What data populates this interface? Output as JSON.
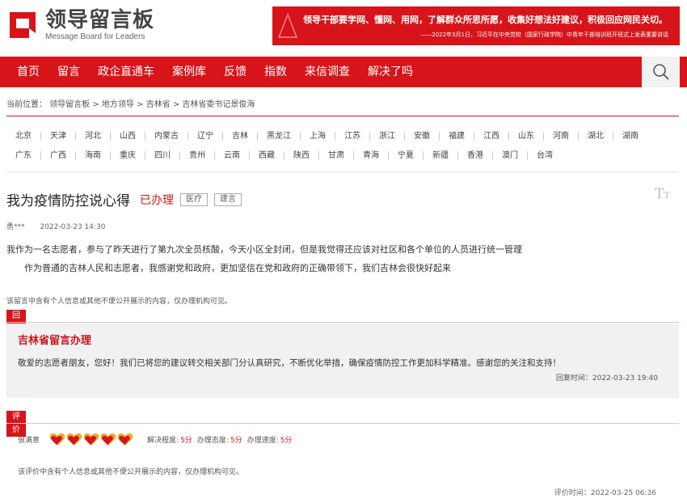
{
  "header": {
    "logo_title": "领导留言板",
    "logo_subtitle": "Message Board for Leaders",
    "banner_main": "领导干部要学网、懂网、用网，了解群众所思所愿，收集好想法好建议，积极回应网民关切。",
    "banner_sub": "——2022年3月1日，习近平在中央党校（国家行政学院）中青年干部培训班开班式上发表重要讲话"
  },
  "nav": {
    "items": [
      "首页",
      "留言",
      "政企直通车",
      "案例库",
      "反馈",
      "指数",
      "来信调查",
      "解决了吗"
    ]
  },
  "breadcrumb": {
    "prefix": "当前位置：",
    "path": "领导留言板 > 地方领导 > 吉林省 > 吉林省委书记景俊海"
  },
  "regions": {
    "row1": [
      "北京",
      "天津",
      "河北",
      "山西",
      "内蒙古",
      "辽宁",
      "吉林",
      "黑龙江",
      "上海",
      "江苏",
      "浙江",
      "安徽",
      "福建",
      "江西",
      "山东",
      "河南",
      "湖北",
      "湖南"
    ],
    "row2": [
      "广东",
      "广西",
      "海南",
      "重庆",
      "四川",
      "贵州",
      "云南",
      "西藏",
      "陕西",
      "甘肃",
      "青海",
      "宁夏",
      "新疆",
      "香港",
      "澳门",
      "台湾"
    ]
  },
  "message": {
    "title": "我为疫情防控说心得",
    "status": "已办理",
    "tags": [
      "医疗",
      "建言"
    ],
    "author": "勇***",
    "date": "2022-03-23 14:30",
    "para1": "我作为一名志愿者，参与了昨天进行了第九次全员核酸，今天小区全封闭，但是我觉得还应该对社区和各个单位的人员进行统一管理",
    "para2": "作为普通的吉林人民和志愿者，我感谢党和政府，更加坚信在党和政府的正确带领下，我们吉林会很快好起来",
    "privacy_note": "该留言中含有个人信息或其他不便公开展示的内容，仅办理机构可见。"
  },
  "reply": {
    "label": "回复",
    "org": "吉林省留言办理",
    "text": "敬爱的志愿者朋友，您好！我们已将您的建议转交相关部门分认真研究，不断优化举措，确保疫情防控工作更加科学精准。感谢您的关注和支持！",
    "time": "回复时间：2022-03-23 19:40"
  },
  "rating": {
    "label": "评价",
    "overall": "很满意",
    "hearts": 5,
    "resolve_label": "解决程度:",
    "resolve_score": "5分",
    "attitude_label": "办理态度:",
    "attitude_score": "5分",
    "speed_label": "办理速度:",
    "speed_score": "5分",
    "note": "该评价中含有个人信息或其他不便公开展示的内容，仅办理机构可见。",
    "time": "评价时间：2022-03-25 06:36"
  },
  "colors": {
    "brand_red": "#d7141a",
    "heart_orange": "#f5a623",
    "heart_red": "#d7141a"
  }
}
